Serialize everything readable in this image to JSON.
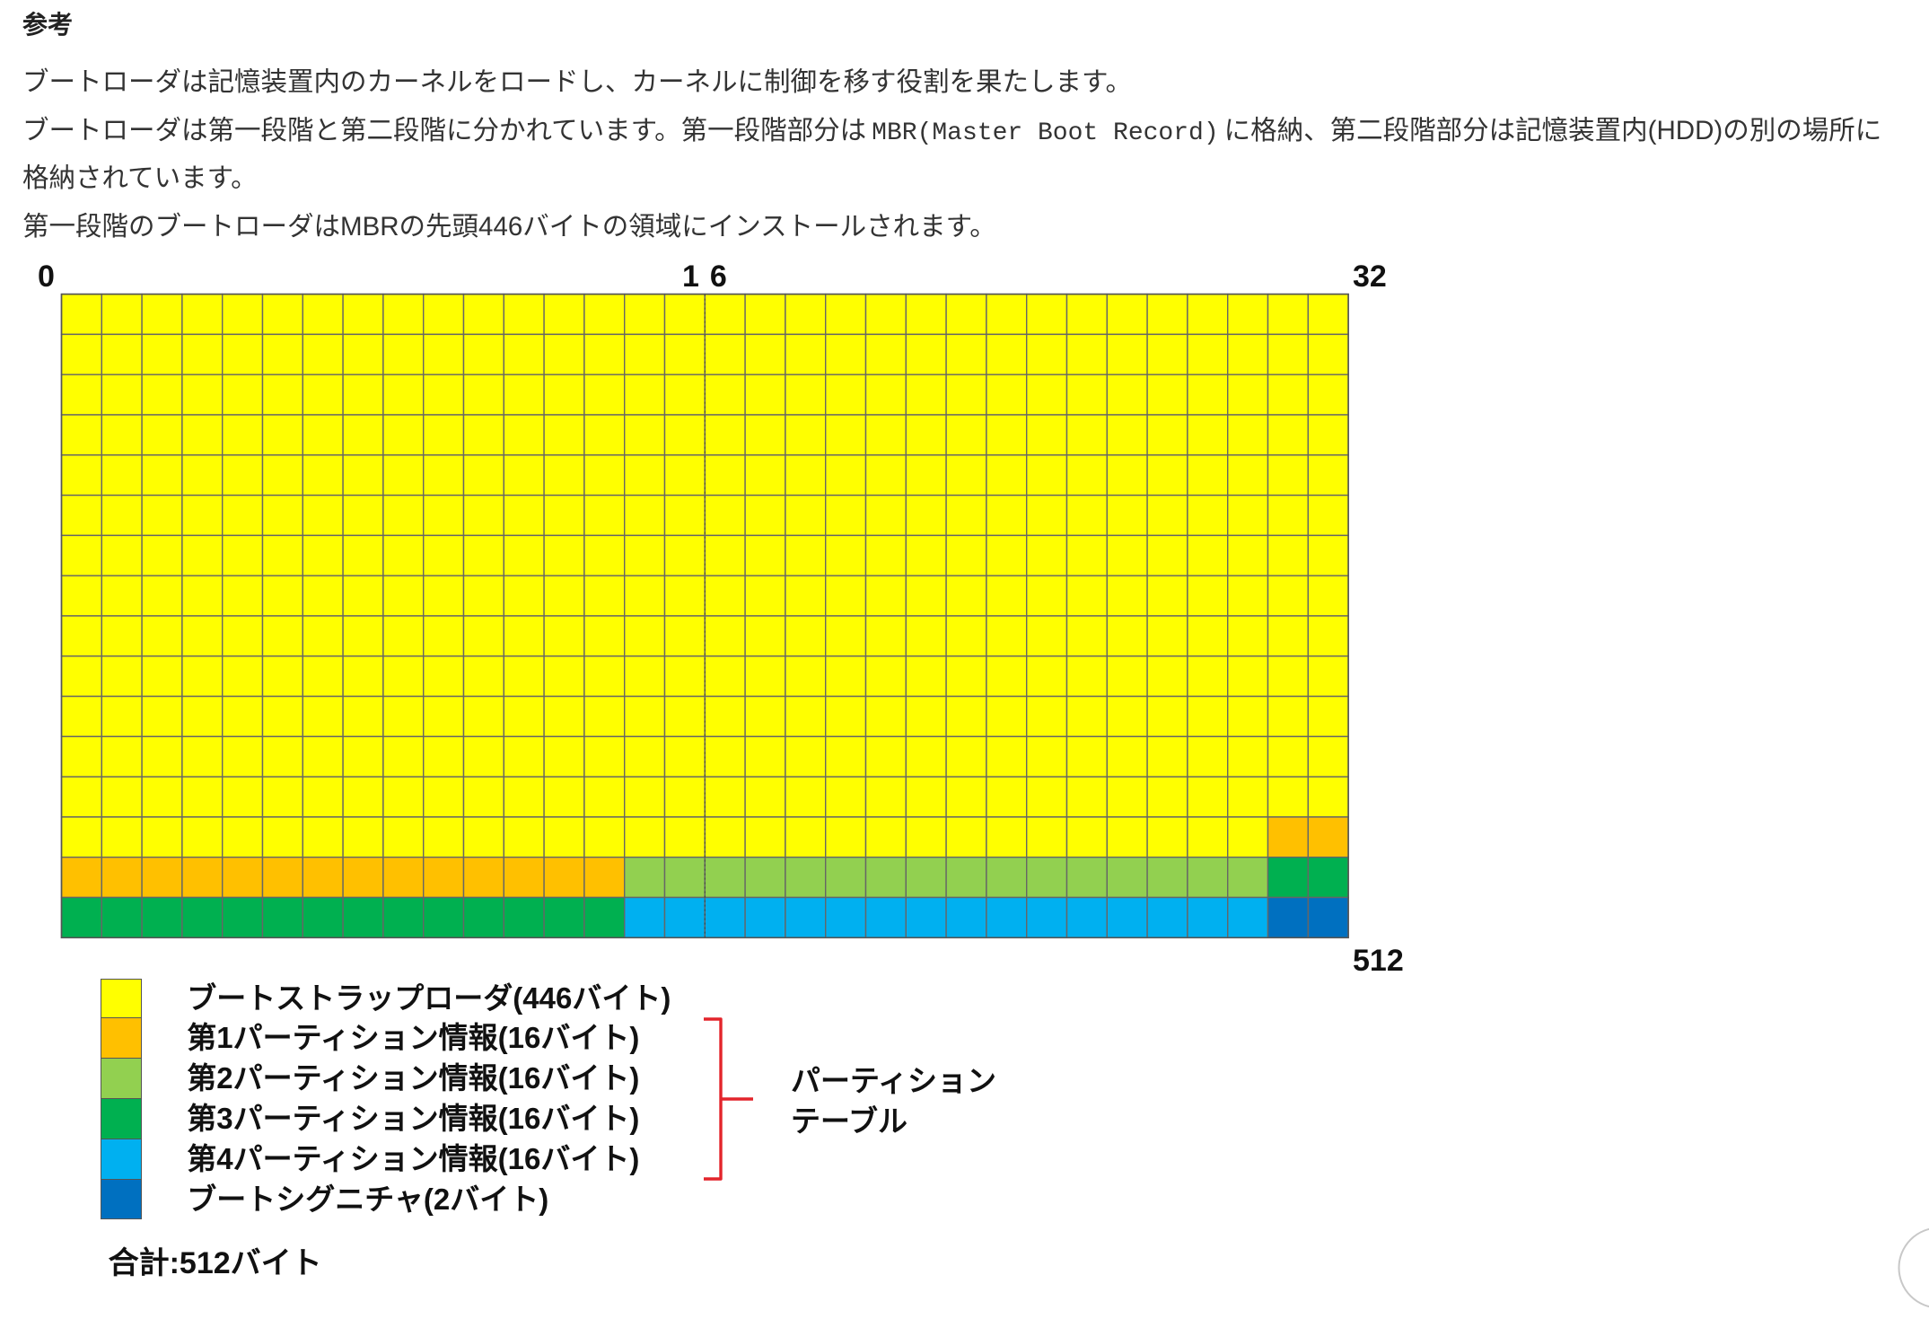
{
  "article": {
    "heading": "参考",
    "p1": "ブートローダは記憶装置内のカーネルをロードし、カーネルに制御を移す役割を果たします。",
    "p2": {
      "before_code": "ブートローダは第一段階と第二段階に分かれています。第一段階部分は",
      "code": "MBR(Master Boot Record)",
      "after_code": "に格納、第二段階部分は記憶装置内(HDD)の別の場所に",
      "continuation": "格納されています。"
    },
    "p3": "第一段階のブートローダはMBRの先頭446バイトの領域にインストールされます。"
  },
  "diagram": {
    "axis_labels": {
      "start": "0",
      "middle": "16",
      "end": "32",
      "last": "512"
    },
    "segments": [
      {
        "label": "ブートストラップローダ(446バイト)",
        "bytes": 446,
        "color": "#ffff00"
      },
      {
        "label": "第1パーティション情報(16バイト)",
        "bytes": 16,
        "color": "#ffc000"
      },
      {
        "label": "第2パーティション情報(16バイト)",
        "bytes": 16,
        "color": "#92d050"
      },
      {
        "label": "第3パーティション情報(16バイト)",
        "bytes": 16,
        "color": "#00b050"
      },
      {
        "label": "第4パーティション情報(16バイト)",
        "bytes": 16,
        "color": "#00b0f0"
      },
      {
        "label": "ブートシグニチャ(2バイト)",
        "bytes": 2,
        "color": "#0070c0"
      }
    ],
    "bracket_label": [
      "パーティション",
      "テーブル"
    ],
    "bracket_color": "#e3242b",
    "total_label": "合計:512バイト"
  }
}
